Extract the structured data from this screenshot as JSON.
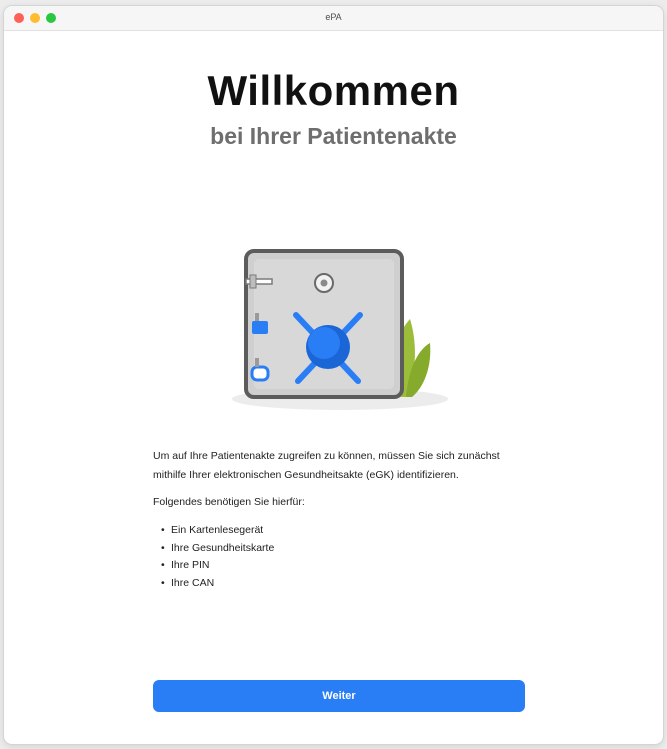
{
  "window": {
    "title": "ePA"
  },
  "welcome": {
    "heading": "Willkommen",
    "subheading": "bei Ihrer Patientenakte"
  },
  "illustration": {
    "icon": "safe-icon",
    "accent_color": "#2a7ef5",
    "plant_color": "#9bbd3a"
  },
  "info": {
    "intro": "Um auf Ihre Patientenakte zugreifen zu können, müssen Sie sich zunächst mithilfe Ihrer elektronischen Gesundheitsakte (eGK) identifizieren.",
    "needs_label": "Folgendes benötigen Sie hierfür:",
    "requirements": [
      "Ein Kartenlesegerät",
      "Ihre Gesundheitskarte",
      "Ihre PIN",
      "Ihre CAN"
    ]
  },
  "actions": {
    "next_label": "Weiter",
    "next_color": "#2a7ef5"
  }
}
